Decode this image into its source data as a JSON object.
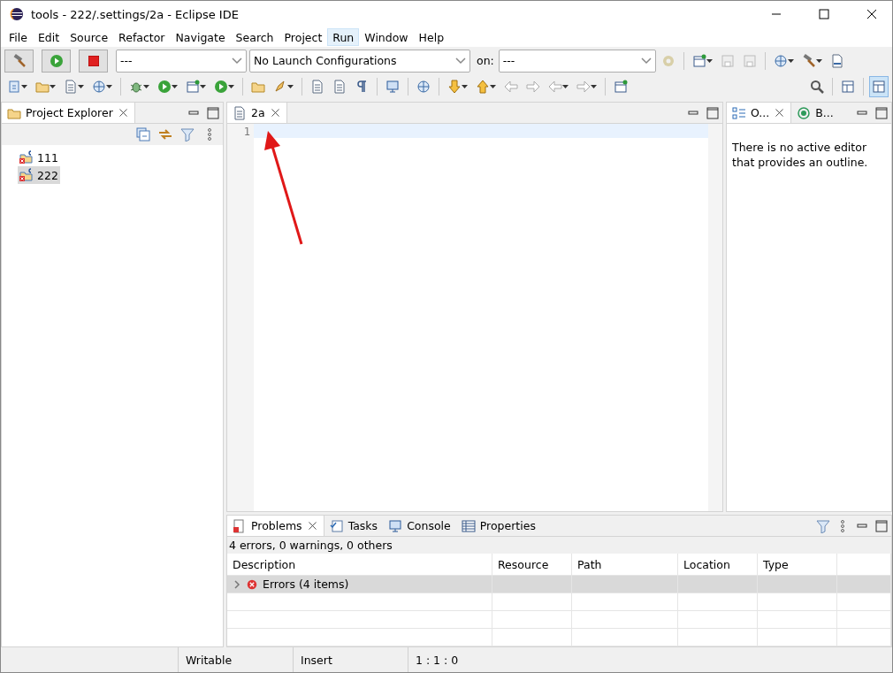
{
  "window": {
    "title": "tools - 222/.settings/2a - Eclipse IDE"
  },
  "menu": [
    {
      "label": "File",
      "selected": false
    },
    {
      "label": "Edit",
      "selected": false
    },
    {
      "label": "Source",
      "selected": false
    },
    {
      "label": "Refactor",
      "selected": false
    },
    {
      "label": "Navigate",
      "selected": false
    },
    {
      "label": "Search",
      "selected": false
    },
    {
      "label": "Project",
      "selected": false
    },
    {
      "label": "Run",
      "selected": true
    },
    {
      "label": "Window",
      "selected": false
    },
    {
      "label": "Help",
      "selected": false
    }
  ],
  "launch_bar": {
    "mode": "---",
    "configuration": "No Launch Configurations",
    "target_label": "on:",
    "target": "---"
  },
  "project_explorer": {
    "title": "Project Explorer",
    "items": [
      {
        "label": "111",
        "selected": false
      },
      {
        "label": "222",
        "selected": true
      }
    ]
  },
  "editor": {
    "tab": "2a",
    "line_numbers": [
      "1"
    ]
  },
  "outline": {
    "tabs": [
      {
        "label": "O...",
        "selected": true
      },
      {
        "label": "B...",
        "selected": false
      }
    ],
    "message": "There is no active editor that provides an outline."
  },
  "problems": {
    "tabs": [
      {
        "label": "Problems",
        "selected": true
      },
      {
        "label": "Tasks",
        "selected": false
      },
      {
        "label": "Console",
        "selected": false
      },
      {
        "label": "Properties",
        "selected": false
      }
    ],
    "summary": "4 errors, 0 warnings, 0 others",
    "columns": [
      "Description",
      "Resource",
      "Path",
      "Location",
      "Type"
    ],
    "rows": [
      {
        "label": "Errors (4 items)",
        "expanded": false
      }
    ]
  },
  "status_bar": [
    "Writable",
    "Insert",
    "1 : 1 : 0"
  ]
}
